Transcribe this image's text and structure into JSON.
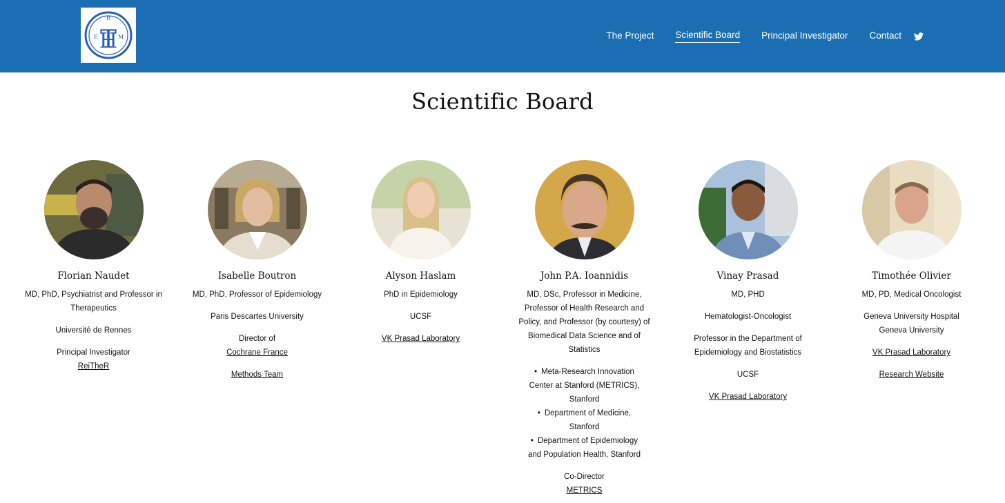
{
  "header": {
    "logo_letters": [
      "R",
      "T",
      "H",
      "E",
      "M"
    ],
    "nav": [
      {
        "label": "The Project",
        "active": false
      },
      {
        "label": "Scientific Board",
        "active": true
      },
      {
        "label": "Principal Investigator",
        "active": false
      },
      {
        "label": "Contact",
        "active": false
      }
    ],
    "twitter_icon": "twitter-icon",
    "brand_color": "#1a6eb1"
  },
  "page": {
    "title": "Scientific Board"
  },
  "members": [
    {
      "name": "Florian Naudet",
      "role": [
        "MD, PhD, Psychiatrist and Professor in",
        "Therapeutics"
      ],
      "affiliation": "Université de Rennes",
      "extra_label": "Principal Investigator",
      "link": "ReiTheR"
    },
    {
      "name": "Isabelle Boutron",
      "role": [
        "MD, PhD, Professor of Epidemiology"
      ],
      "affiliation": "Paris Descartes University",
      "extra_label": "Director of",
      "link": "Cochrane France",
      "link2": "Methods Team"
    },
    {
      "name": "Alyson Haslam",
      "role": [
        "PhD in Epidemiology"
      ],
      "affiliation": "UCSF",
      "link": "VK Prasad Laboratory"
    },
    {
      "name": "John P.A. Ioannidis",
      "role": [
        "MD, DSc, Professor in Medicine,",
        "Professor of Health Research and",
        "Policy, and Professor (by courtesy) of",
        "Biomedical Data Science and of",
        "Statistics"
      ],
      "bullets": [
        [
          "Meta-Research Innovation",
          "Center at Stanford (METRICS),",
          "Stanford"
        ],
        [
          "Department of Medicine,",
          "Stanford"
        ],
        [
          "Department of Epidemiology",
          "and Population Health, Stanford"
        ]
      ],
      "extra_label": "Co-Director",
      "link": "METRICS"
    },
    {
      "name": "Vinay Prasad",
      "role": [
        "MD, PHD"
      ],
      "specialty": "Hematologist-Oncologist",
      "department": [
        "Professor in the Department of",
        "Epidemiology and Biostatistics"
      ],
      "affiliation": "UCSF",
      "link": "VK Prasad Laboratory"
    },
    {
      "name": "Timothée Olivier",
      "role": [
        "MD, PD, Medical Oncologist"
      ],
      "affiliation": [
        "Geneva University Hospital",
        "Geneva University"
      ],
      "link": "VK Prasad Laboratory",
      "link2": "Research Website"
    }
  ]
}
